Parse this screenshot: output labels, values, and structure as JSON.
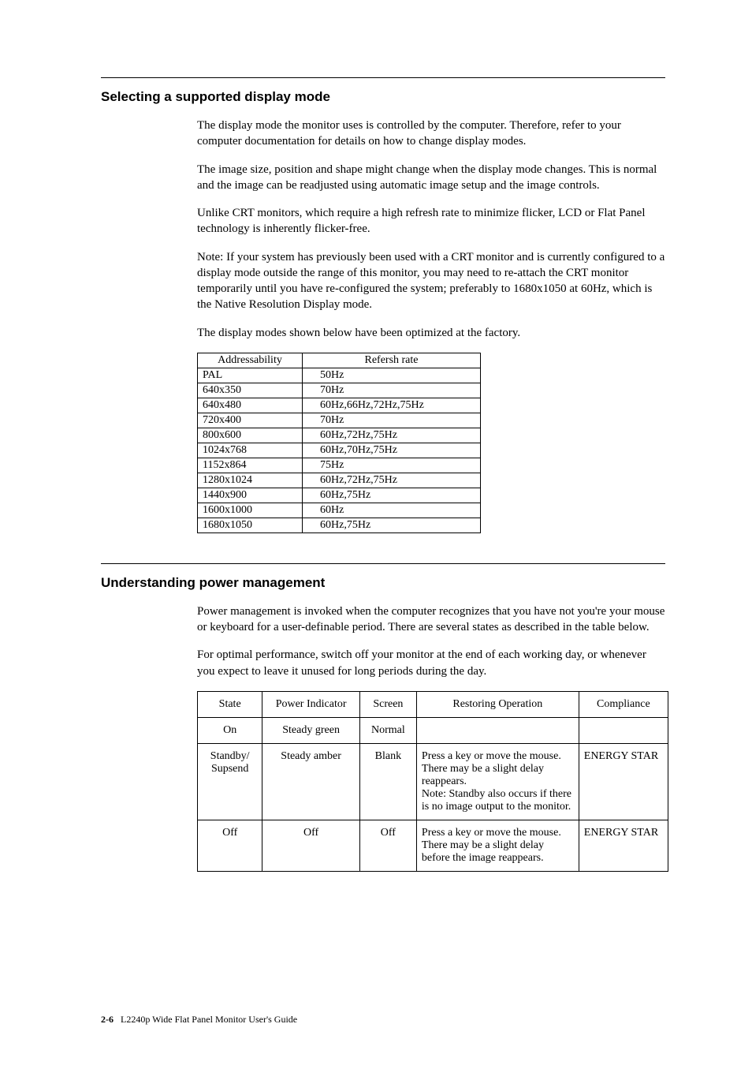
{
  "section1": {
    "title": "Selecting a supported display mode",
    "p1": "The display mode the monitor uses is controlled by the computer. Therefore, refer  to your computer documentation for details on how to change display modes.",
    "p2": "The image size, position and shape might change when the display mode changes. This is normal and the image can be readjusted using automatic image setup and the image controls.",
    "p3": "Unlike CRT monitors, which require a high refresh rate to minimize flicker, LCD or Flat Panel technology is inherently flicker-free.",
    "p4": "Note: If your system has previously been used with a CRT monitor and is currently configured to a display mode outside the range of this monitor, you may need to re-attach the CRT monitor temporarily until you have re-configured the system; preferably to 1680x1050 at 60Hz, which is the Native Resolution Display mode.",
    "p5": "The display modes shown below have been optimized at the factory."
  },
  "modes_table": {
    "headers": {
      "c0": "Addressability",
      "c1": "Refersh rate"
    },
    "rows": [
      {
        "c0": "PAL",
        "c1": "50Hz"
      },
      {
        "c0": "640x350",
        "c1": "70Hz"
      },
      {
        "c0": "640x480",
        "c1": "60Hz,66Hz,72Hz,75Hz"
      },
      {
        "c0": "720x400",
        "c1": "70Hz"
      },
      {
        "c0": "800x600",
        "c1": "60Hz,72Hz,75Hz"
      },
      {
        "c0": "1024x768",
        "c1": "60Hz,70Hz,75Hz"
      },
      {
        "c0": "1152x864",
        "c1": "75Hz"
      },
      {
        "c0": "1280x1024",
        "c1": "60Hz,72Hz,75Hz"
      },
      {
        "c0": "1440x900",
        "c1": "60Hz,75Hz"
      },
      {
        "c0": "1600x1000",
        "c1": "60Hz"
      },
      {
        "c0": "1680x1050",
        "c1": "60Hz,75Hz"
      }
    ]
  },
  "section2": {
    "title": "Understanding power management",
    "p1": "Power management is invoked when the computer recognizes that you have not you're your mouse or keyboard for a user-definable period. There are several states as described in the table below.",
    "p2": "For optimal performance, switch off your monitor at the end of each working day, or whenever you expect to leave it unused for long periods during the day."
  },
  "power_table": {
    "headers": {
      "c0": "State",
      "c1": "Power Indicator",
      "c2": "Screen",
      "c3": "Restoring Operation",
      "c4": "Compliance"
    },
    "rows": [
      {
        "c0": "On",
        "c1": "Steady green",
        "c2": "Normal",
        "c3": "",
        "c4": ""
      },
      {
        "c0": "Standby/\nSupsend",
        "c1": "Steady amber",
        "c2": "Blank",
        "c3": "Press a key or move the mouse.\nThere may be a slight delay reappears.\nNote: Standby also occurs if there is no image output to the monitor.",
        "c4": "ENERGY STAR"
      },
      {
        "c0": "Off",
        "c1": "Off",
        "c2": "Off",
        "c3": "Press a key or move the mouse.\nThere may be a slight delay before the image reappears.",
        "c4": "ENERGY STAR"
      }
    ]
  },
  "footer": {
    "pagenum": "2-6",
    "title": "L2240p Wide Flat Panel Monitor User's Guide"
  }
}
